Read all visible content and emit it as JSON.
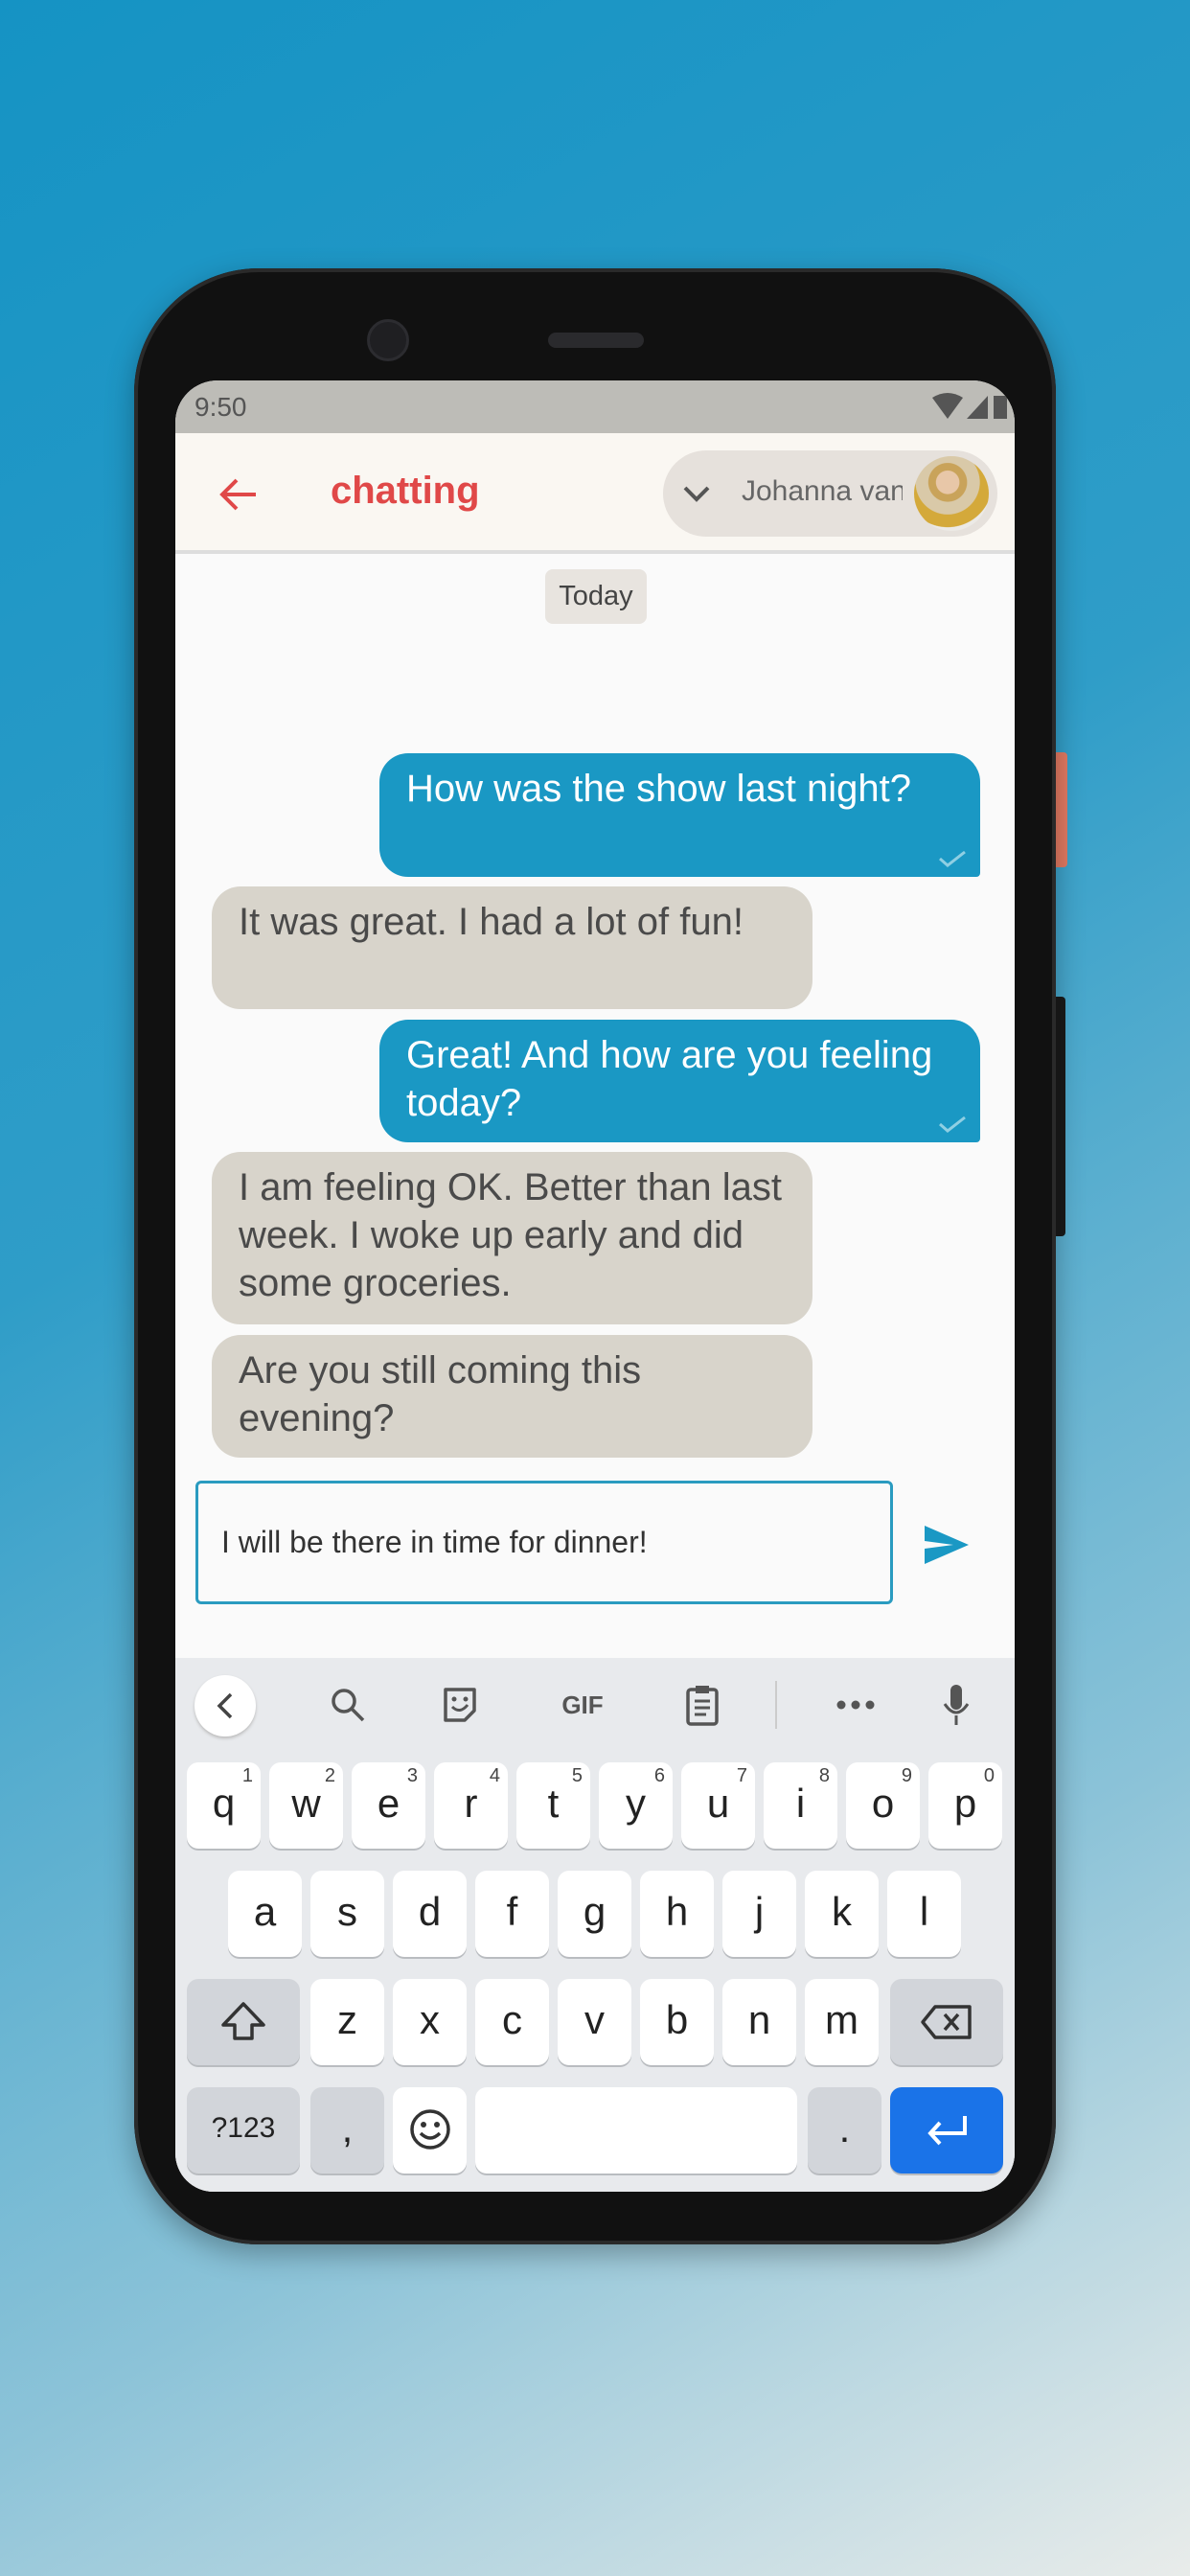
{
  "status": {
    "time": "9:50"
  },
  "header": {
    "title": "chatting",
    "contact_name": "Johanna van"
  },
  "chat": {
    "date_chip": "Today",
    "messages": [
      {
        "from": "me",
        "text": "How was the show last night?",
        "read": true
      },
      {
        "from": "them",
        "text": "It was great. I had a lot of fun!"
      },
      {
        "from": "me",
        "text": "Great! And how are you feeling today?",
        "read": true
      },
      {
        "from": "them",
        "text": "I am feeling OK. Better than last week. I woke up early and did some groceries."
      },
      {
        "from": "them",
        "text": "Are you still coming this evening?"
      }
    ]
  },
  "composer": {
    "value": "I will be there in time for dinner!"
  },
  "keyboard": {
    "gif": "GIF",
    "row1": [
      "q",
      "w",
      "e",
      "r",
      "t",
      "y",
      "u",
      "i",
      "o",
      "p"
    ],
    "row1_hints": [
      "1",
      "2",
      "3",
      "4",
      "5",
      "6",
      "7",
      "8",
      "9",
      "0"
    ],
    "row2": [
      "a",
      "s",
      "d",
      "f",
      "g",
      "h",
      "j",
      "k",
      "l"
    ],
    "row3": [
      "z",
      "x",
      "c",
      "v",
      "b",
      "n",
      "m"
    ],
    "symbols": "?123",
    "comma": ",",
    "period": "."
  },
  "colors": {
    "accent": "#e04848",
    "sent_bubble": "#1a98c4",
    "received_bubble": "#d8d4cb",
    "enter_key": "#1a73e8"
  }
}
